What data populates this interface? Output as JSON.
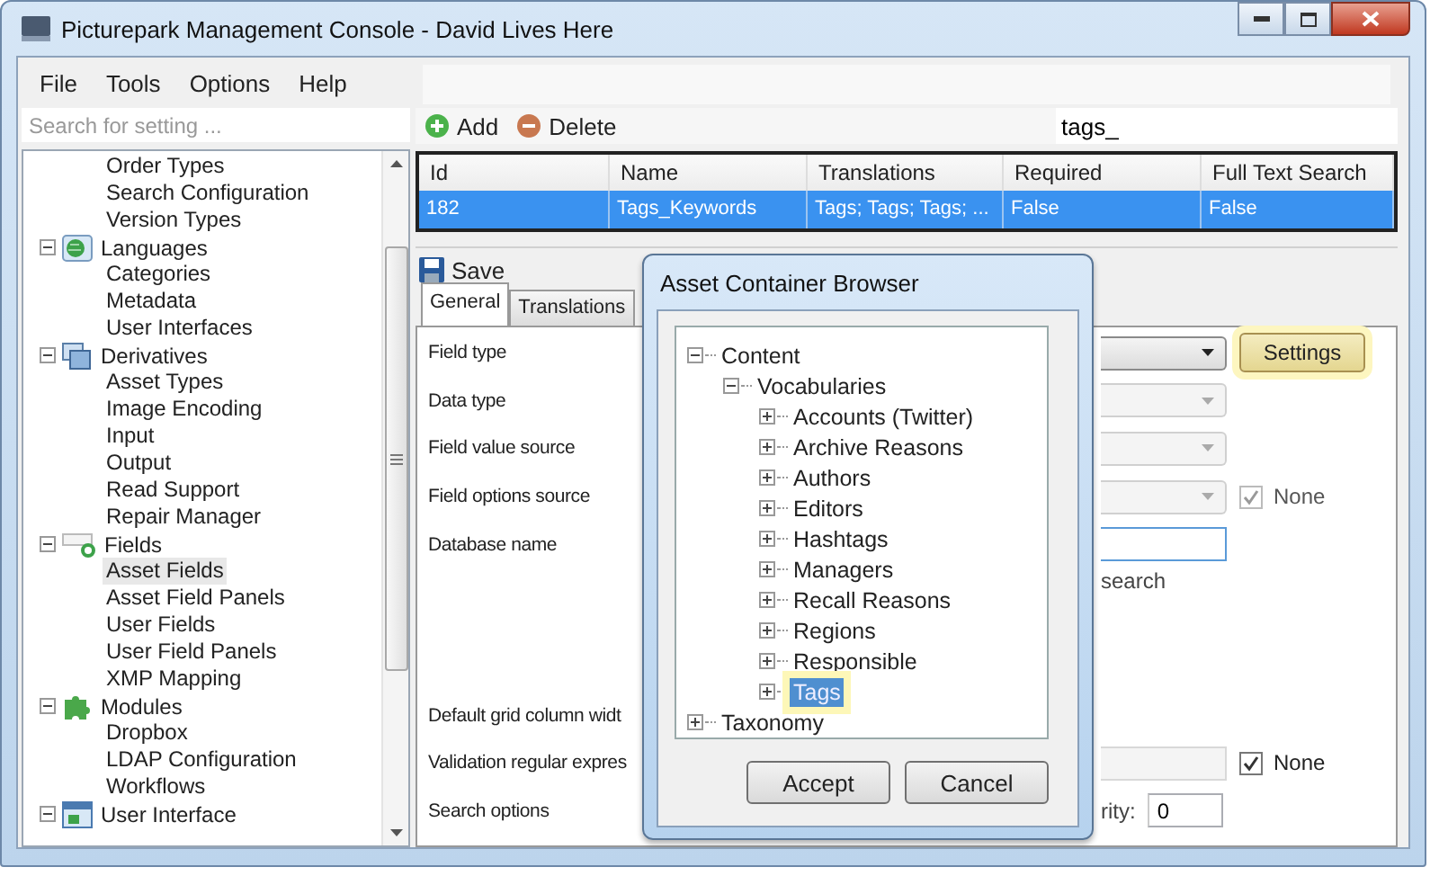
{
  "window": {
    "title": "Picturepark Management Console - David Lives Here"
  },
  "menu": [
    {
      "label": "File"
    },
    {
      "label": "Tools"
    },
    {
      "label": "Options"
    },
    {
      "label": "Help"
    }
  ],
  "sidebar": {
    "search": {
      "placeholder": "Search for setting ..."
    },
    "tree": [
      {
        "children": [
          {
            "label": "Order Types",
            "selected": false
          },
          {
            "label": "Search Configuration",
            "selected": false
          },
          {
            "label": "Version Types",
            "selected": false
          }
        ]
      },
      {
        "label": "Languages",
        "expanded": true,
        "children": [
          {
            "label": "Categories",
            "selected": false
          },
          {
            "label": "Metadata",
            "selected": false
          },
          {
            "label": "User Interfaces",
            "selected": false
          }
        ]
      },
      {
        "label": "Derivatives",
        "expanded": true,
        "children": [
          {
            "label": "Asset Types",
            "selected": false
          },
          {
            "label": "Image Encoding",
            "selected": false
          },
          {
            "label": "Input",
            "selected": false
          },
          {
            "label": "Output",
            "selected": false
          },
          {
            "label": "Read Support",
            "selected": false
          },
          {
            "label": "Repair Manager",
            "selected": false
          }
        ]
      },
      {
        "label": "Fields",
        "expanded": true,
        "children": [
          {
            "label": "Asset Fields",
            "selected": true
          },
          {
            "label": "Asset Field Panels",
            "selected": false
          },
          {
            "label": "User Fields",
            "selected": false
          },
          {
            "label": "User Field Panels",
            "selected": false
          },
          {
            "label": "XMP Mapping",
            "selected": false
          }
        ]
      },
      {
        "label": "Modules",
        "expanded": true,
        "children": [
          {
            "label": "Dropbox",
            "selected": false
          },
          {
            "label": "LDAP Configuration",
            "selected": false
          },
          {
            "label": "Workflows",
            "selected": false
          }
        ]
      },
      {
        "label": "User Interface",
        "expanded": true
      }
    ]
  },
  "toolbar": {
    "buttons": [
      {
        "label": "Add",
        "kind": "add"
      },
      {
        "label": "Delete",
        "kind": "delete"
      }
    ],
    "search": {
      "value": "tags_"
    }
  },
  "table": {
    "columns": [
      "Id",
      "Name",
      "Translations",
      "Required",
      "Full Text Search"
    ],
    "rows": [
      {
        "cells": [
          "182",
          "Tags_Keywords",
          "Tags; Tags; Tags; ...",
          "False",
          "False"
        ],
        "selected": true
      }
    ]
  },
  "save_button": {
    "label": "Save"
  },
  "tabs": [
    {
      "label": "General",
      "selected": true
    },
    {
      "label": "Translations",
      "selected": false
    }
  ],
  "form": {
    "upper": [
      {
        "label": "Field type",
        "control": {
          "kind": "combo",
          "disabled": false
        },
        "button": {
          "label": "Settings",
          "highlighted": true
        }
      },
      {
        "label": "Data type",
        "control": {
          "kind": "combo",
          "disabled": true
        }
      },
      {
        "label": "Field value source",
        "control": {
          "kind": "combo",
          "disabled": true
        }
      },
      {
        "label": "Field options source",
        "control": {
          "kind": "combo",
          "disabled": true
        },
        "checkbox": {
          "label": "None",
          "checked": true,
          "disabled": true
        }
      },
      {
        "label": "Database name",
        "control": {
          "kind": "text",
          "disabled": false,
          "focused": true
        }
      },
      {
        "note": "search"
      }
    ],
    "lower": [
      {
        "label": "Default grid column widt"
      },
      {
        "label": "Validation regular expres",
        "control": {
          "kind": "text",
          "disabled": true,
          "focused": false
        },
        "checkbox": {
          "label": "None",
          "checked": true,
          "disabled": false
        }
      },
      {
        "label": "Search options",
        "note": "rity:",
        "control": {
          "kind": "text",
          "value": "0",
          "disabled": false,
          "focused": false
        }
      }
    ]
  },
  "dialog": {
    "title": "Asset Container Browser",
    "tree": [
      {
        "label": "Content",
        "expanded": true,
        "selected": false,
        "children": [
          {
            "label": "Vocabularies",
            "expanded": true,
            "selected": false,
            "children": [
              {
                "label": "Accounts (Twitter)",
                "expanded": false,
                "selected": false
              },
              {
                "label": "Archive Reasons",
                "expanded": false,
                "selected": false
              },
              {
                "label": "Authors",
                "expanded": false,
                "selected": false
              },
              {
                "label": "Editors",
                "expanded": false,
                "selected": false
              },
              {
                "label": "Hashtags",
                "expanded": false,
                "selected": false
              },
              {
                "label": "Managers",
                "expanded": false,
                "selected": false
              },
              {
                "label": "Recall Reasons",
                "expanded": false,
                "selected": false
              },
              {
                "label": "Regions",
                "expanded": false,
                "selected": false
              },
              {
                "label": "Responsible",
                "expanded": false,
                "selected": false
              },
              {
                "label": "Tags",
                "expanded": false,
                "selected": true
              }
            ]
          }
        ]
      },
      {
        "label": "Taxonomy",
        "expanded": false,
        "selected": false
      }
    ],
    "buttons": [
      {
        "label": "Accept"
      },
      {
        "label": "Cancel"
      }
    ]
  }
}
